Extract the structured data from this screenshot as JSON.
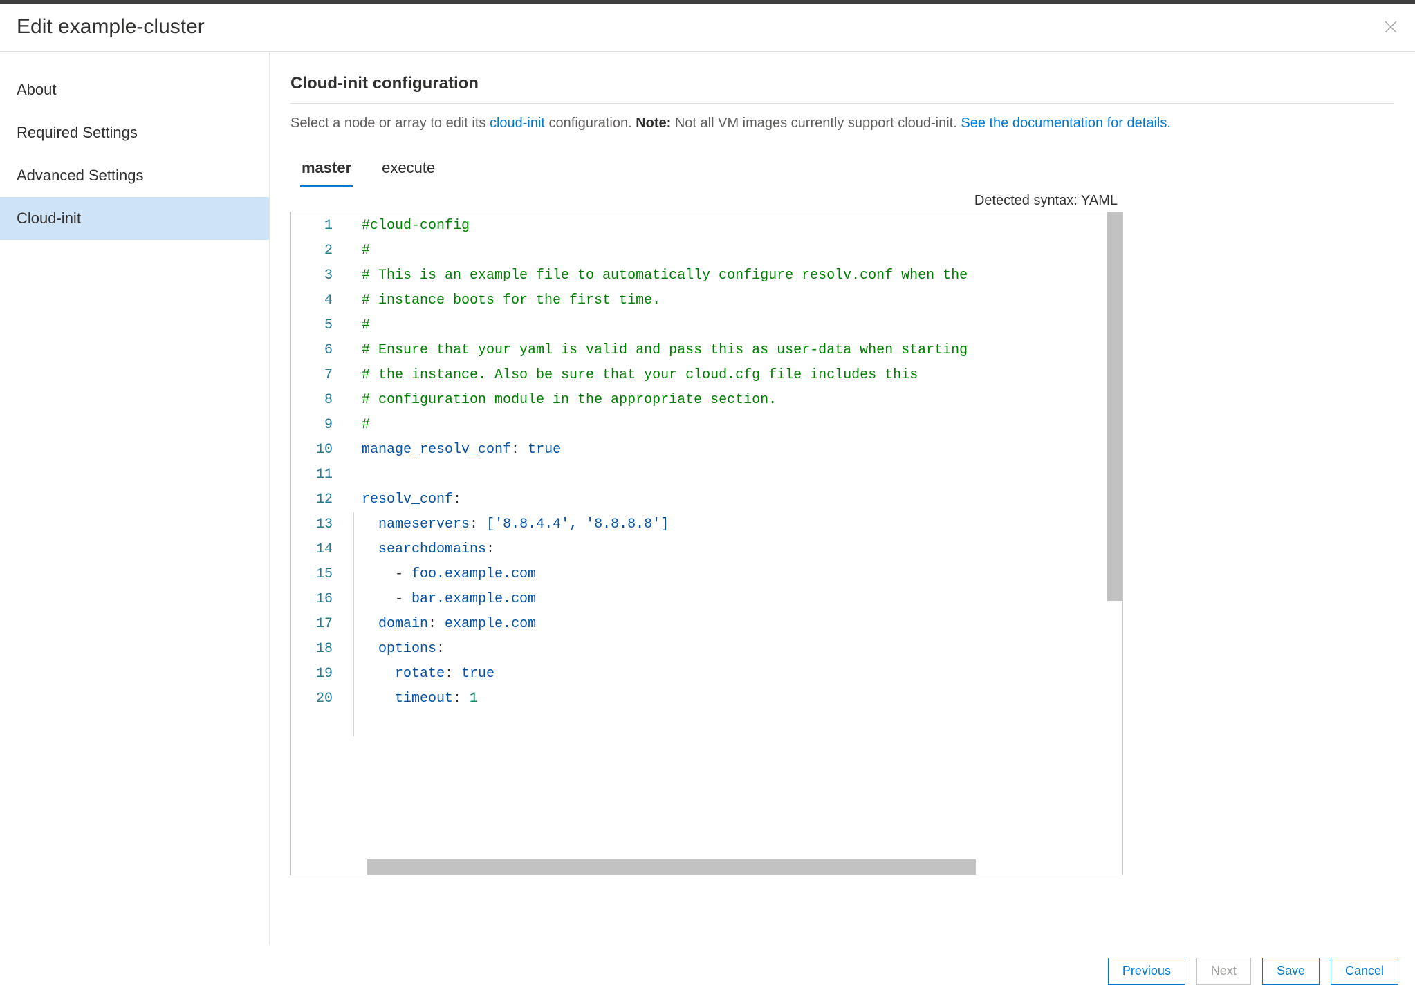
{
  "header": {
    "title": "Edit example-cluster"
  },
  "sidebar": {
    "items": [
      {
        "label": "About"
      },
      {
        "label": "Required Settings"
      },
      {
        "label": "Advanced Settings"
      },
      {
        "label": "Cloud-init"
      }
    ],
    "selected_index": 3
  },
  "main": {
    "section_title": "Cloud-init configuration",
    "description_prefix": "Select a node or array to edit its ",
    "description_link1": "cloud-init",
    "description_mid": " configuration. ",
    "description_note_label": "Note:",
    "description_note_text": " Not all VM images currently support cloud-init. ",
    "description_link2": "See the documentation for details."
  },
  "tabs": [
    {
      "label": "master"
    },
    {
      "label": "execute"
    }
  ],
  "tabs_selected_index": 0,
  "syntax": {
    "label": "Detected syntax: ",
    "value": "YAML"
  },
  "code": {
    "line_count": 20,
    "lines": [
      {
        "n": 1,
        "raw": "#cloud-config",
        "type": "comment"
      },
      {
        "n": 2,
        "raw": "#",
        "type": "comment"
      },
      {
        "n": 3,
        "raw": "# This is an example file to automatically configure resolv.conf when the",
        "type": "comment"
      },
      {
        "n": 4,
        "raw": "# instance boots for the first time.",
        "type": "comment"
      },
      {
        "n": 5,
        "raw": "#",
        "type": "comment"
      },
      {
        "n": 6,
        "raw": "# Ensure that your yaml is valid and pass this as user-data when starting",
        "type": "comment"
      },
      {
        "n": 7,
        "raw": "# the instance. Also be sure that your cloud.cfg file includes this",
        "type": "comment"
      },
      {
        "n": 8,
        "raw": "# configuration module in the appropriate section.",
        "type": "comment"
      },
      {
        "n": 9,
        "raw": "#",
        "type": "comment"
      },
      {
        "n": 10,
        "key": "manage_resolv_conf",
        "sep": ": ",
        "val": "true",
        "type": "kv"
      },
      {
        "n": 11,
        "raw": "",
        "type": "blank"
      },
      {
        "n": 12,
        "key": "resolv_conf",
        "sep": ":",
        "type": "keyonly",
        "indent": ""
      },
      {
        "n": 13,
        "indent": "  ",
        "key": "nameservers",
        "sep": ": ",
        "val": "['8.8.4.4', '8.8.8.8']",
        "type": "kv"
      },
      {
        "n": 14,
        "indent": "  ",
        "key": "searchdomains",
        "sep": ":",
        "type": "keyonly"
      },
      {
        "n": 15,
        "indent": "    ",
        "dash": "- ",
        "val": "foo.example.com",
        "type": "listitem"
      },
      {
        "n": 16,
        "indent": "    ",
        "dash": "- ",
        "val": "bar.example.com",
        "type": "listitem"
      },
      {
        "n": 17,
        "indent": "  ",
        "key": "domain",
        "sep": ": ",
        "val": "example.com",
        "type": "kv-plain"
      },
      {
        "n": 18,
        "indent": "  ",
        "key": "options",
        "sep": ":",
        "type": "keyonly"
      },
      {
        "n": 19,
        "indent": "    ",
        "key": "rotate",
        "sep": ": ",
        "val": "true",
        "type": "kv"
      },
      {
        "n": 20,
        "indent": "    ",
        "key": "timeout",
        "sep": ": ",
        "val": "1",
        "type": "kv-num"
      }
    ]
  },
  "footer": {
    "previous": "Previous",
    "next": "Next",
    "save": "Save",
    "cancel": "Cancel"
  }
}
